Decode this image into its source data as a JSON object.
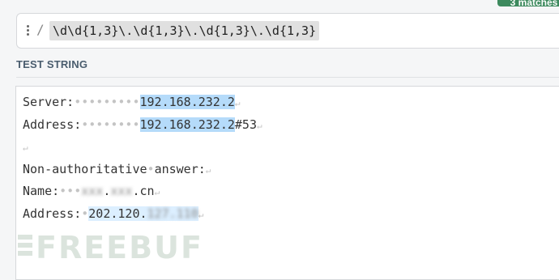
{
  "matches_badge": "3 matches",
  "regex": {
    "delimiter": "/",
    "pattern": "\\d\\d{1,3}\\.\\d{1,3}\\.\\d{1,3}\\.\\d{1,3}"
  },
  "test_string": {
    "label": "TEST STRING",
    "lines": [
      {
        "prefix": "Server:",
        "spaces": 9,
        "match": "192.168.232.2",
        "suffix": ""
      },
      {
        "prefix": "Address:",
        "spaces": 8,
        "match": "192.168.232.2",
        "suffix": "#53"
      },
      {
        "prefix": "",
        "spaces": 0,
        "match": "",
        "suffix": ""
      },
      {
        "prefix": "Non-authoritative",
        "mid": "answer:"
      },
      {
        "prefix": "Name:",
        "spaces": 3,
        "blur1": "xxx",
        "mid": ".",
        "blur2": "xxx",
        "suffix": ".cn"
      },
      {
        "prefix": "Address:",
        "spaces": 1,
        "match": "202.120.",
        "blur": "127.110",
        "suffix": ""
      }
    ]
  },
  "watermark": "FREEBUF"
}
